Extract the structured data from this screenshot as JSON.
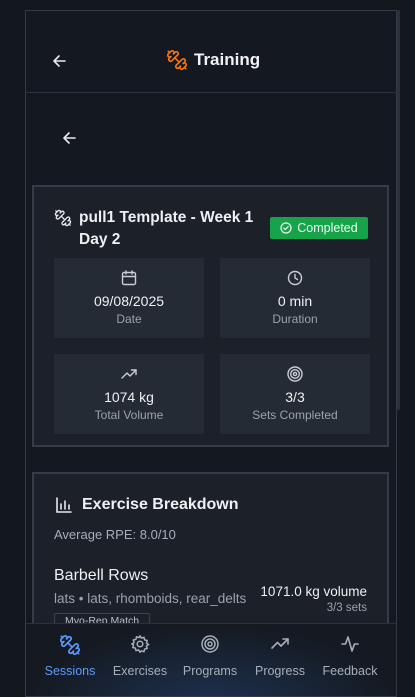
{
  "header": {
    "title": "Training",
    "brand_color": "#f97316"
  },
  "session": {
    "title": "pull1 Template - Week 1 Day 2",
    "status": "Completed",
    "status_color": "#16a34a",
    "stats": [
      {
        "icon": "calendar-icon",
        "value": "09/08/2025",
        "label": "Date"
      },
      {
        "icon": "clock-icon",
        "value": "0 min",
        "label": "Duration"
      },
      {
        "icon": "trending-up-icon",
        "value": "1074 kg",
        "label": "Total Volume"
      },
      {
        "icon": "target-icon",
        "value": "3/3",
        "label": "Sets Completed"
      }
    ]
  },
  "breakdown": {
    "title": "Exercise Breakdown",
    "average_rpe": "Average RPE: 8.0/10",
    "exercises": [
      {
        "name": "Barbell Rows",
        "muscles": "lats • lats, rhomboids, rear_delts",
        "volume": "1071.0 kg volume",
        "sets": "3/3 sets",
        "tag": "Myo-Rep Match"
      }
    ]
  },
  "nav": {
    "active_color": "#5b9cff",
    "items": [
      {
        "label": "Sessions",
        "icon": "dumbbell-icon",
        "active": true
      },
      {
        "label": "Exercises",
        "icon": "gear-icon"
      },
      {
        "label": "Programs",
        "icon": "target-icon"
      },
      {
        "label": "Progress",
        "icon": "trending-up-icon"
      },
      {
        "label": "Feedback",
        "icon": "activity-icon"
      }
    ]
  }
}
